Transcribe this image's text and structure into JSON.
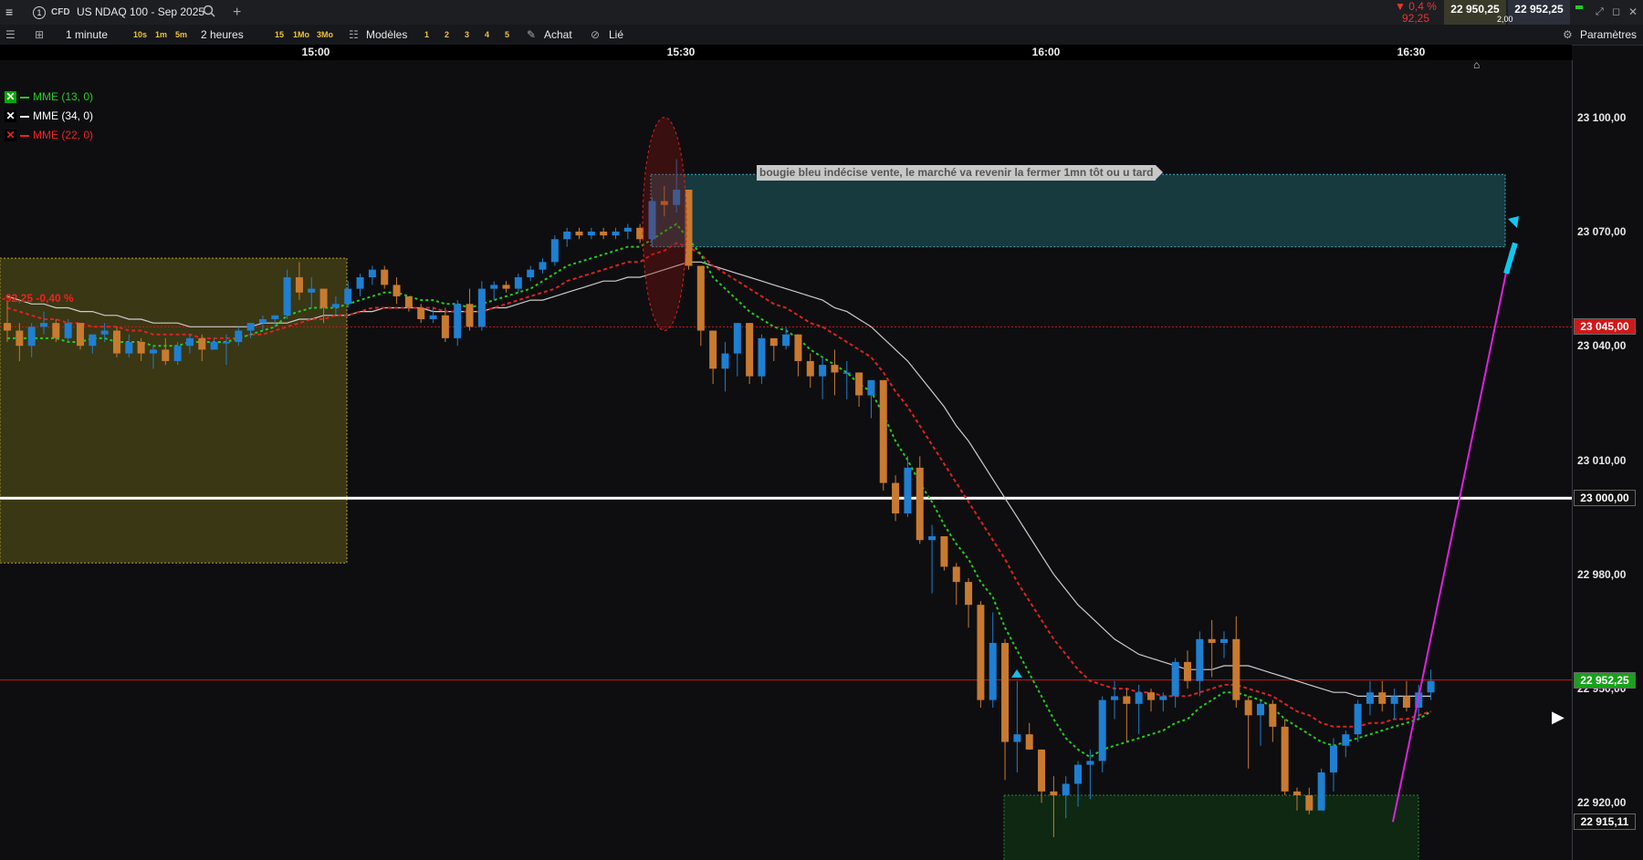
{
  "header": {
    "menu_icon": "hamburger-icon",
    "info_icon": "info-circle-icon",
    "cfd_badge": "CFD",
    "instrument": "US NDAQ 100 - Sep 2025",
    "search_icon": "search-icon",
    "add_icon": "plus-icon",
    "change_pct": "▼ 0,4 %",
    "change_abs": "92,25",
    "bid": "22 950,25",
    "ask": "22 952,25",
    "spread": "2,00"
  },
  "toolbar": {
    "timeframe": "1 minute",
    "tf_buttons": [
      "10s",
      "1m",
      "5m"
    ],
    "period": "2 heures",
    "period_buttons": [
      "15",
      "1Mo",
      "3Mo"
    ],
    "models": "Modèles",
    "model_buttons": [
      "1",
      "2",
      "3",
      "4",
      "5"
    ],
    "buy": "Achat",
    "linked": "Lié",
    "settings": "Paramètres"
  },
  "legend": [
    {
      "label": "MME (13, 0)",
      "color": "#22cc22"
    },
    {
      "label": "MME (34, 0)",
      "color": "#ffffff"
    },
    {
      "label": "MME (22, 0)",
      "color": "#dd2222"
    }
  ],
  "annotation": {
    "note": "bougie bleu indécise vente, le marché va revenir la fermer 1mn tôt ou u tard"
  },
  "left_label": "-92,25 -0,40 %",
  "colors": {
    "bull": "#1f7fd1",
    "bear": "#c87a30",
    "ema_fast": "#22cc22",
    "ema_mid": "#dd2222",
    "ema_slow": "#cccccc"
  },
  "chart_data": {
    "type": "candlestick",
    "x_ticks": [
      "15:00",
      "15:30",
      "16:00",
      "16:30"
    ],
    "y_ticks": [
      {
        "value": 23100,
        "label": "23 100,00"
      },
      {
        "value": 23070,
        "label": "23 070,00"
      },
      {
        "value": 23040,
        "label": "23 040,00"
      },
      {
        "value": 23010,
        "label": "23 010,00"
      },
      {
        "value": 22980,
        "label": "22 980,00"
      },
      {
        "value": 22950,
        "label": "22 950,00"
      },
      {
        "value": 22920,
        "label": "22 920,00"
      }
    ],
    "ylim": [
      22905,
      23115
    ],
    "price_tags": [
      {
        "value": 23045,
        "label": "23 045,00",
        "bg": "#d01818",
        "fg": "#ffffff"
      },
      {
        "value": 23000,
        "label": "23 000,00",
        "bg": "#101010",
        "fg": "#ffffff"
      },
      {
        "value": 22952.25,
        "label": "22 952,25",
        "bg": "#1aa01a",
        "fg": "#ffffff"
      },
      {
        "value": 22915.11,
        "label": "22 915,11",
        "bg": "#101010",
        "fg": "#ffffff"
      }
    ],
    "candles": [
      [
        23046,
        23052,
        23041,
        23044
      ],
      [
        23044,
        23046,
        23036,
        23040
      ],
      [
        23040,
        23046,
        23037,
        23045
      ],
      [
        23045,
        23049,
        23043,
        23046
      ],
      [
        23046,
        23047,
        23041,
        23042
      ],
      [
        23042,
        23047,
        23041,
        23046
      ],
      [
        23046,
        23046,
        23039,
        23040
      ],
      [
        23040,
        23043,
        23038,
        23043
      ],
      [
        23043,
        23046,
        23041,
        23044
      ],
      [
        23044,
        23045,
        23037,
        23038
      ],
      [
        23038,
        23043,
        23037,
        23041
      ],
      [
        23041,
        23042,
        23036,
        23038
      ],
      [
        23038,
        23040,
        23034,
        23039
      ],
      [
        23039,
        23042,
        23035,
        23036
      ],
      [
        23036,
        23041,
        23035,
        23040
      ],
      [
        23040,
        23043,
        23038,
        23042
      ],
      [
        23042,
        23043,
        23036,
        23039
      ],
      [
        23039,
        23042,
        23039,
        23041
      ],
      [
        23041,
        23043,
        23035,
        23041
      ],
      [
        23041,
        23045,
        23040,
        23044
      ],
      [
        23044,
        23046,
        23042,
        23046
      ],
      [
        23046,
        23048,
        23044,
        23047
      ],
      [
        23047,
        23048,
        23045,
        23048
      ],
      [
        23048,
        23060,
        23047,
        23058
      ],
      [
        23058,
        23062,
        23052,
        23054
      ],
      [
        23054,
        23058,
        23050,
        23055
      ],
      [
        23055,
        23055,
        23046,
        23050
      ],
      [
        23050,
        23053,
        23048,
        23051
      ],
      [
        23051,
        23057,
        23050,
        23055
      ],
      [
        23055,
        23059,
        23053,
        23058
      ],
      [
        23058,
        23061,
        23056,
        23060
      ],
      [
        23060,
        23061,
        23055,
        23056
      ],
      [
        23056,
        23058,
        23051,
        23053
      ],
      [
        23053,
        23053,
        23049,
        23050
      ],
      [
        23050,
        23051,
        23046,
        23047
      ],
      [
        23047,
        23050,
        23046,
        23048
      ],
      [
        23048,
        23050,
        23041,
        23042
      ],
      [
        23042,
        23052,
        23040,
        23051
      ],
      [
        23051,
        23055,
        23044,
        23045
      ],
      [
        23045,
        23057,
        23044,
        23055
      ],
      [
        23055,
        23057,
        23052,
        23056
      ],
      [
        23056,
        23057,
        23054,
        23055
      ],
      [
        23055,
        23059,
        23054,
        23058
      ],
      [
        23058,
        23061,
        23057,
        23060
      ],
      [
        23060,
        23063,
        23059,
        23062
      ],
      [
        23062,
        23069,
        23061,
        23068
      ],
      [
        23068,
        23071,
        23066,
        23070
      ],
      [
        23070,
        23071,
        23068,
        23069
      ],
      [
        23069,
        23071,
        23068,
        23070
      ],
      [
        23070,
        23071,
        23068,
        23069
      ],
      [
        23069,
        23071,
        23068,
        23070
      ],
      [
        23070,
        23072,
        23068,
        23071
      ],
      [
        23071,
        23072,
        23067,
        23068
      ],
      [
        23068,
        23079,
        23066,
        23078
      ],
      [
        23078,
        23082,
        23074,
        23077
      ],
      [
        23077,
        23089,
        23075,
        23081
      ],
      [
        23081,
        23081,
        23060,
        23061
      ],
      [
        23061,
        23061,
        23040,
        23044
      ],
      [
        23044,
        23044,
        23030,
        23034
      ],
      [
        23034,
        23041,
        23028,
        23038
      ],
      [
        23038,
        23044,
        23032,
        23046
      ],
      [
        23046,
        23046,
        23030,
        23032
      ],
      [
        23032,
        23043,
        23030,
        23042
      ],
      [
        23042,
        23042,
        23036,
        23040
      ],
      [
        23040,
        23045,
        23039,
        23043
      ],
      [
        23043,
        23043,
        23032,
        23036
      ],
      [
        23036,
        23038,
        23029,
        23032
      ],
      [
        23032,
        23037,
        23026,
        23035
      ],
      [
        23035,
        23039,
        23027,
        23033
      ],
      [
        23033,
        23036,
        23026,
        23033
      ],
      [
        23033,
        23033,
        23024,
        23027
      ],
      [
        23027,
        23031,
        23021,
        23031
      ],
      [
        23031,
        23031,
        23002,
        23004
      ],
      [
        23004,
        23006,
        22994,
        22996
      ],
      [
        22996,
        23011,
        22995,
        23008
      ],
      [
        23008,
        23011,
        22988,
        22989
      ],
      [
        22989,
        22993,
        22975,
        22990
      ],
      [
        22990,
        22990,
        22981,
        22982
      ],
      [
        22982,
        22983,
        22972,
        22978
      ],
      [
        22978,
        22979,
        22966,
        22972
      ],
      [
        22972,
        22973,
        22945,
        22947
      ],
      [
        22947,
        22970,
        22945,
        22962
      ],
      [
        22962,
        22963,
        22926,
        22936
      ],
      [
        22936,
        22952,
        22928,
        22938
      ],
      [
        22938,
        22941,
        22934,
        22934
      ],
      [
        22934,
        22934,
        22920,
        22923
      ],
      [
        22923,
        22927,
        22911,
        22922
      ],
      [
        22922,
        22927,
        22916,
        22925
      ],
      [
        22925,
        22931,
        22919,
        22930
      ],
      [
        22930,
        22934,
        22921,
        22931
      ],
      [
        22931,
        22948,
        22928,
        22947
      ],
      [
        22947,
        22952,
        22942,
        22948
      ],
      [
        22948,
        22950,
        22936,
        22946
      ],
      [
        22946,
        22951,
        22938,
        22949
      ],
      [
        22949,
        22950,
        22944,
        22947
      ],
      [
        22947,
        22949,
        22944,
        22948
      ],
      [
        22948,
        22958,
        22945,
        22957
      ],
      [
        22957,
        22960,
        22950,
        22952
      ],
      [
        22952,
        22965,
        22948,
        22963
      ],
      [
        22963,
        22968,
        22953,
        22962
      ],
      [
        22962,
        22965,
        22958,
        22963
      ],
      [
        22963,
        22969,
        22945,
        22947
      ],
      [
        22947,
        22948,
        22929,
        22943
      ],
      [
        22943,
        22947,
        22935,
        22946
      ],
      [
        22946,
        22947,
        22936,
        22940
      ],
      [
        22940,
        22942,
        22922,
        22923
      ],
      [
        22923,
        22924,
        22918,
        22922
      ],
      [
        22922,
        22924,
        22917,
        22918
      ],
      [
        22918,
        22929,
        22920,
        22928
      ],
      [
        22928,
        22937,
        22923,
        22935
      ],
      [
        22935,
        22939,
        22932,
        22938
      ],
      [
        22938,
        22947,
        22936,
        22946
      ],
      [
        22946,
        22952,
        22943,
        22949
      ],
      [
        22949,
        22952,
        22944,
        22946
      ],
      [
        22946,
        22950,
        22942,
        22948
      ],
      [
        22948,
        22952,
        22944,
        22945
      ],
      [
        22945,
        22951,
        22942,
        22949
      ],
      [
        22949,
        22955,
        22947,
        22952
      ]
    ],
    "ema_fast": [
      23042,
      23042,
      23042,
      23042,
      23042,
      23041,
      23041,
      23042,
      23042,
      23041,
      23041,
      23041,
      23040,
      23040,
      23040,
      23041,
      23041,
      23041,
      23041,
      23042,
      23043,
      23044,
      23045,
      23048,
      23049,
      23050,
      23050,
      23050,
      23051,
      23052,
      23053,
      23054,
      23054,
      23053,
      23052,
      23052,
      23051,
      23051,
      23050,
      23051,
      23052,
      23053,
      23054,
      23055,
      23057,
      23059,
      23061,
      23062,
      23063,
      23064,
      23065,
      23066,
      23066,
      23068,
      23070,
      23072,
      23068,
      23064,
      23058,
      23055,
      23052,
      23049,
      23047,
      23045,
      23044,
      23042,
      23039,
      23037,
      23035,
      23033,
      23030,
      23028,
      23022,
      23015,
      23010,
      23004,
      22999,
      22993,
      22988,
      22984,
      22978,
      22974,
      22966,
      22960,
      22954,
      22948,
      22942,
      22937,
      22934,
      22932,
      22934,
      22935,
      22936,
      22937,
      22938,
      22939,
      22941,
      22942,
      22945,
      22947,
      22949,
      22949,
      22948,
      22947,
      22945,
      22942,
      22940,
      22938,
      22936,
      22935,
      22936,
      22937,
      22938,
      22939,
      22940,
      22941,
      22942,
      22944
    ],
    "ema_mid": [
      23050,
      23049,
      23048,
      23047,
      23047,
      23046,
      23046,
      23045,
      23045,
      23045,
      23044,
      23044,
      23043,
      23043,
      23043,
      23043,
      23042,
      23042,
      23042,
      23042,
      23043,
      23043,
      23044,
      23045,
      23046,
      23047,
      23047,
      23048,
      23048,
      23049,
      23050,
      23050,
      23050,
      23050,
      23050,
      23050,
      23049,
      23049,
      23049,
      23049,
      23050,
      23051,
      23052,
      23053,
      23054,
      23055,
      23057,
      23058,
      23059,
      23060,
      23061,
      23062,
      23062,
      23064,
      23065,
      23067,
      23066,
      23064,
      23061,
      23059,
      23057,
      23055,
      23053,
      23051,
      23050,
      23048,
      23046,
      23045,
      23043,
      23041,
      23039,
      23037,
      23033,
      23028,
      23024,
      23019,
      23014,
      23009,
      23004,
      22999,
      22994,
      22989,
      22984,
      22978,
      22973,
      22968,
      22963,
      22959,
      22955,
      22952,
      22951,
      22950,
      22950,
      22949,
      22949,
      22948,
      22948,
      22948,
      22949,
      22950,
      22951,
      22951,
      22950,
      22949,
      22948,
      22946,
      22944,
      22943,
      22941,
      22940,
      22940,
      22940,
      22941,
      22941,
      22942,
      22942,
      22943,
      22944
    ],
    "ema_slow": [
      23053,
      23052,
      23051,
      23051,
      23050,
      23050,
      23049,
      23049,
      23048,
      23048,
      23047,
      23047,
      23046,
      23046,
      23046,
      23045,
      23045,
      23045,
      23045,
      23045,
      23045,
      23046,
      23046,
      23046,
      23047,
      23047,
      23048,
      23048,
      23048,
      23049,
      23049,
      23050,
      23050,
      23050,
      23050,
      23049,
      23049,
      23049,
      23049,
      23049,
      23050,
      23050,
      23051,
      23052,
      23052,
      23053,
      23054,
      23055,
      23056,
      23057,
      23057,
      23058,
      23058,
      23059,
      23060,
      23061,
      23062,
      23062,
      23061,
      23060,
      23059,
      23058,
      23057,
      23056,
      23055,
      23054,
      23053,
      23052,
      23050,
      23049,
      23047,
      23045,
      23042,
      23039,
      23036,
      23032,
      23028,
      23024,
      23019,
      23015,
      23010,
      23005,
      23000,
      22995,
      22990,
      22985,
      22980,
      22976,
      22972,
      22969,
      22966,
      22963,
      22961,
      22959,
      22958,
      22957,
      22956,
      22955,
      22955,
      22955,
      22956,
      22956,
      22956,
      22955,
      22954,
      22953,
      22952,
      22951,
      22950,
      22949,
      22949,
      22948,
      22948,
      22948,
      22948,
      22948,
      22948,
      22948
    ]
  }
}
